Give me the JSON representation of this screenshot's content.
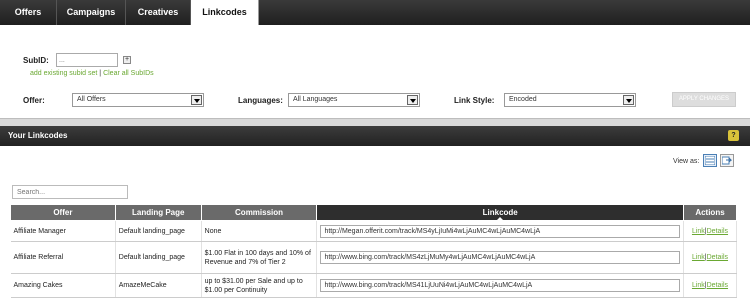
{
  "tabs": [
    {
      "label": "Offers",
      "active": false
    },
    {
      "label": "Campaigns",
      "active": false
    },
    {
      "label": "Creatives",
      "active": false
    },
    {
      "label": "Linkcodes",
      "active": true
    }
  ],
  "filters": {
    "subid_label": "SubID:",
    "subid_placeholder": "...",
    "plus_glyph": "+",
    "add_existing_link": "add existing subid set",
    "separator": "|",
    "clear_all_link": "Clear all SubIDs",
    "offer_label": "Offer:",
    "offer_value": "All Offers",
    "languages_label": "Languages:",
    "languages_value": "All Languages",
    "link_style_label": "Link Style:",
    "link_style_value": "Encoded",
    "apply_button": "APPLY CHANGES"
  },
  "linkcodes": {
    "title": "Your Linkcodes",
    "help_glyph": "?",
    "view_as_label": "View as:",
    "view_icons": [
      "list-view-icon",
      "export-view-icon"
    ],
    "search_placeholder": "Search...",
    "columns": [
      "Offer",
      "Landing Page",
      "Commission",
      "Linkcode",
      "Actions"
    ],
    "rows": [
      {
        "offer": "Affiliate Manager",
        "landing_page": "Default landing_page",
        "commission": "None",
        "linkcode": "http://Megan.offerit.com/track/MS4yLjIuMi4wLjAuMC4wLjAuMC4wLjA",
        "link_action": "Link",
        "details_action": "Details"
      },
      {
        "offer": "Affiliate Referral",
        "landing_page": "Default landing_page",
        "commission": "$1.00 Flat in 100 days and 10% of Revenue and 7% of Tier 2",
        "linkcode": "http://www.bing.com/track/MS4zLjMuMy4wLjAuMC4wLjAuMC4wLjA",
        "link_action": "Link",
        "details_action": "Details"
      },
      {
        "offer": "Amazing Cakes",
        "landing_page": "AmazeMeCake",
        "commission": "up to $31.00 per Sale and up to $1.00 per Continuity",
        "linkcode": "http://www.bing.com/track/MS41LjUuNi4wLjAuMC4wLjAuMC4wLjA",
        "link_action": "Link",
        "details_action": "Details"
      }
    ]
  },
  "colors": {
    "accent_green": "#6aa832",
    "dark_bar": "#222222",
    "header_gray": "#6a6a6a",
    "help_yellow": "#d8c23a"
  }
}
